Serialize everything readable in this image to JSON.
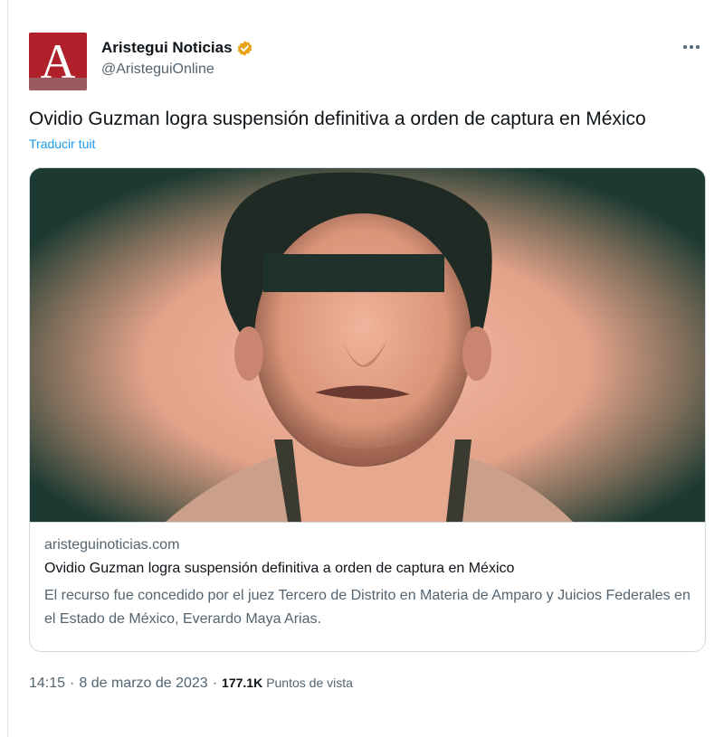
{
  "author": {
    "display_name": "Aristegui Noticias",
    "handle": "@AristeguiOnline",
    "avatar_letter": "A",
    "avatar_color": "#b0202a",
    "verified_badge_color": "#e8a317"
  },
  "tweet": {
    "text": "Ovidio Guzman logra suspensión definitiva a orden de captura en México",
    "translate_label": "Traducir tuit"
  },
  "card": {
    "image_icon": "portrait-photo",
    "domain": "aristeguinoticias.com",
    "title": "Ovidio Guzman logra suspensión definitiva a orden de captura en México",
    "description": "El recurso fue concedido por el juez Tercero de Distrito en Materia de Amparo y Juicios Federales en el Estado de México, Everardo Maya Arias."
  },
  "meta": {
    "time": "14:15",
    "separator": "·",
    "date": "8 de marzo de 2023",
    "views_count": "177.1K",
    "views_label": "Puntos de vista"
  },
  "colors": {
    "accent": "#1d9bf0",
    "secondary_text": "#536471",
    "photo_tint": "#e8a58e",
    "photo_shadow": "#1c3a32"
  }
}
